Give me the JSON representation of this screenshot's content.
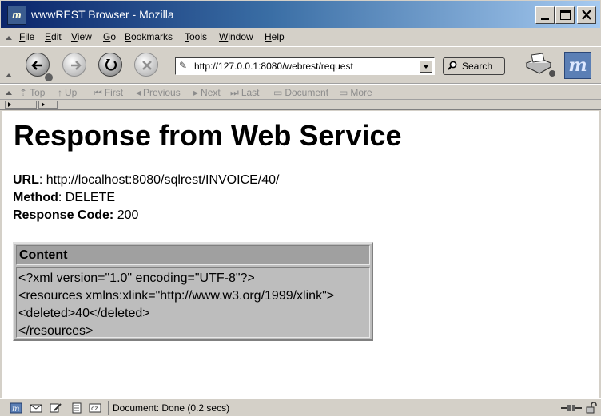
{
  "window": {
    "title": "wwwREST Browser - Mozilla",
    "icon_label": "m"
  },
  "menu": [
    {
      "key": "F",
      "rest": "ile"
    },
    {
      "key": "E",
      "rest": "dit"
    },
    {
      "key": "V",
      "rest": "iew"
    },
    {
      "key": "G",
      "rest": "o"
    },
    {
      "key": "B",
      "rest": "ookmarks"
    },
    {
      "key": "T",
      "rest": "ools"
    },
    {
      "key": "W",
      "rest": "indow"
    },
    {
      "key": "H",
      "rest": "elp"
    }
  ],
  "nav": {
    "url": "http://127.0.0.1:8080/webrest/request",
    "search_label": "Search",
    "brand_logo": "m"
  },
  "site_nav": [
    {
      "icon": "top-icon",
      "glyph": "⇡",
      "label": "Top"
    },
    {
      "icon": "up-icon",
      "glyph": "↑",
      "label": "Up"
    },
    {
      "icon": "first-icon",
      "glyph": "⏮",
      "label": "First"
    },
    {
      "icon": "previous-icon",
      "glyph": "◂",
      "label": "Previous"
    },
    {
      "icon": "next-icon",
      "glyph": "▸",
      "label": "Next"
    },
    {
      "icon": "last-icon",
      "glyph": "⏭",
      "label": "Last"
    },
    {
      "icon": "document-icon",
      "glyph": "▭",
      "label": "Document"
    },
    {
      "icon": "more-icon",
      "glyph": "▭",
      "label": "More"
    }
  ],
  "page": {
    "heading": "Response from Web Service",
    "url_label": "URL",
    "url_value": ": http://localhost:8080/sqlrest/INVOICE/40/",
    "method_label": "Method",
    "method_value": ": DELETE",
    "code_label": "Response Code:",
    "code_value": " 200",
    "content_header": "Content",
    "content_lines": [
      "<?xml version=\"1.0\" encoding=\"UTF-8\"?>",
      "<resources xmlns:xlink=\"http://www.w3.org/1999/xlink\">",
      "<deleted>40</deleted>",
      "</resources>"
    ]
  },
  "status": {
    "text": "Document: Done (0.2 secs)"
  },
  "colors": {
    "titlebar_start": "#0a246a",
    "titlebar_end": "#a6caf0",
    "chrome": "#d4d0c8",
    "content_table_bg": "#bdbdbd",
    "content_header_bg": "#a0a0a0"
  }
}
